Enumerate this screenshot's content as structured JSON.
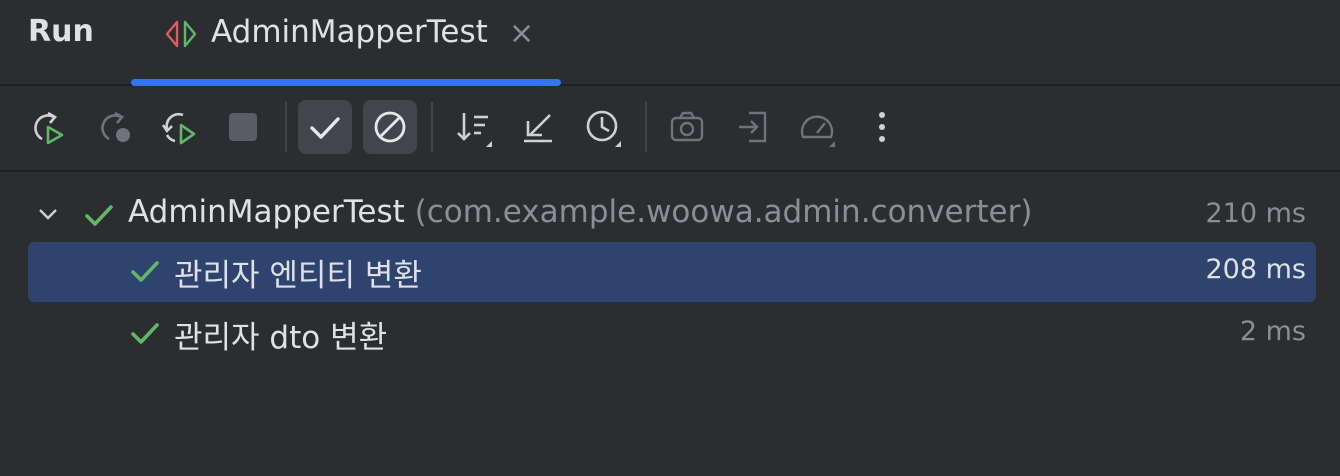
{
  "panel": {
    "title": "Run"
  },
  "tab": {
    "title": "AdminMapperTest",
    "close_glyph": "×"
  },
  "toolbar": {
    "buttons": [
      {
        "name": "rerun-icon",
        "active": false,
        "enabled": true
      },
      {
        "name": "rerun-failed-icon",
        "active": false,
        "enabled": false
      },
      {
        "name": "toggle-auto-test-icon",
        "active": false,
        "enabled": true
      },
      {
        "name": "stop-icon",
        "active": false,
        "enabled": false
      },
      {
        "name": "show-passed-icon",
        "active": true,
        "enabled": true
      },
      {
        "name": "show-ignored-icon",
        "active": true,
        "enabled": true
      },
      {
        "name": "sort-icon",
        "active": false,
        "enabled": true
      },
      {
        "name": "collapse-all-icon",
        "active": false,
        "enabled": true
      },
      {
        "name": "test-history-icon",
        "active": false,
        "enabled": true
      },
      {
        "name": "screenshot-icon",
        "active": false,
        "enabled": false
      },
      {
        "name": "import-tests-icon",
        "active": false,
        "enabled": false
      },
      {
        "name": "coverage-icon",
        "active": false,
        "enabled": false
      },
      {
        "name": "more-options-icon",
        "active": false,
        "enabled": true
      }
    ]
  },
  "tree": {
    "root": {
      "name": "AdminMapperTest",
      "package": "(com.example.woowa.admin.converter)",
      "time": "210 ms",
      "status": "passed"
    },
    "children": [
      {
        "name": "관리자 엔티티 변환",
        "time": "208 ms",
        "status": "passed",
        "selected": true
      },
      {
        "name": "관리자 dto 변환",
        "time": "2 ms",
        "status": "passed",
        "selected": false
      }
    ]
  },
  "colors": {
    "background": "#2b2d30",
    "accent": "#3574f0",
    "selection": "#2e436e",
    "pass_green": "#5fb865",
    "muted_text": "#8b8e94"
  }
}
